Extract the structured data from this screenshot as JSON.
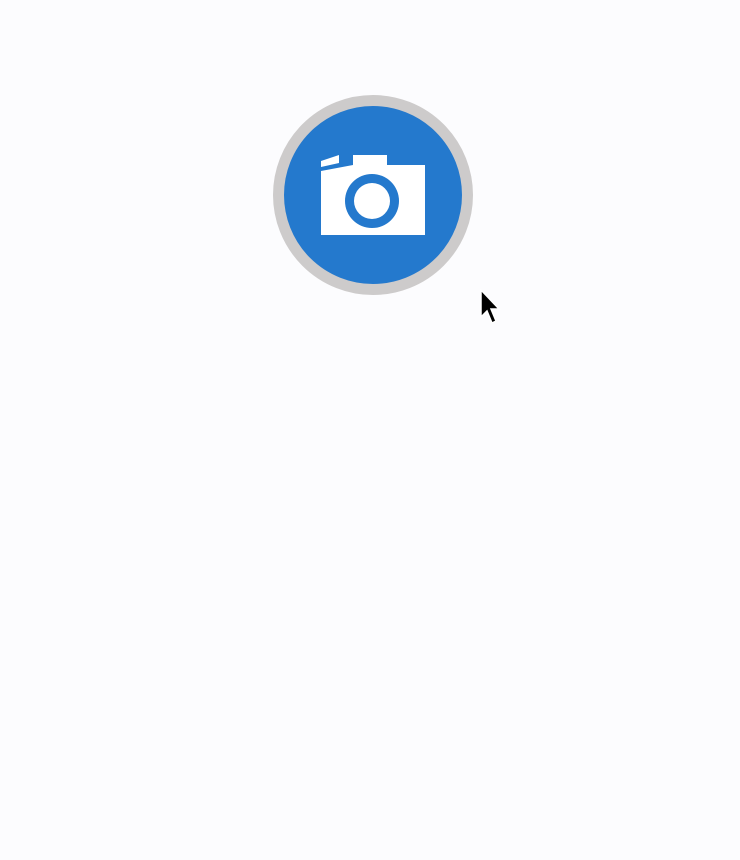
{
  "capture_button": {
    "icon": "camera-icon",
    "ring_color": "#cdcbcb",
    "fill_color": "#2479cd",
    "icon_color": "#ffffff"
  },
  "pointer": {
    "icon": "mouse-cursor-icon"
  }
}
